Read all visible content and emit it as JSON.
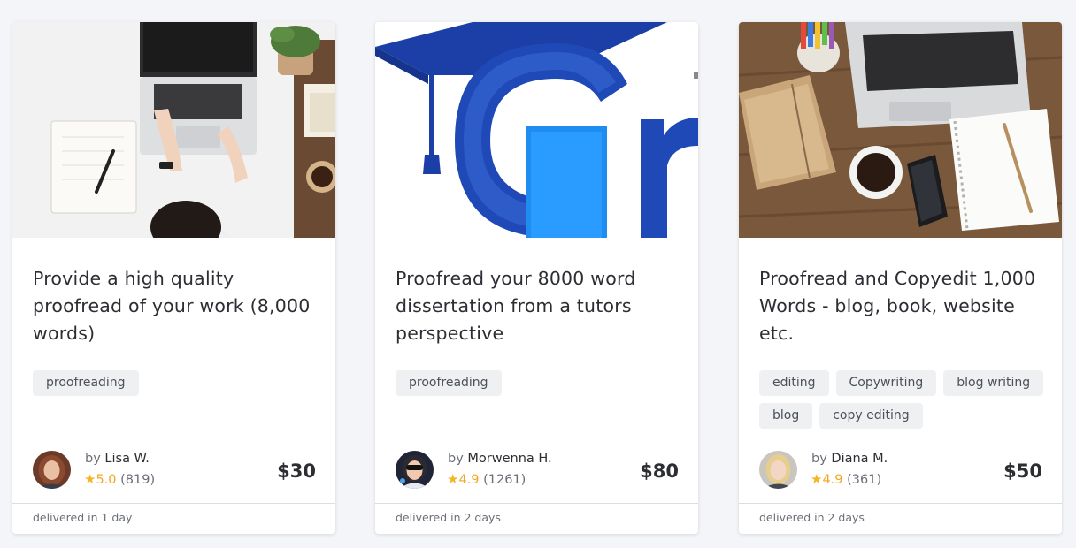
{
  "cards": [
    {
      "image_alt": "laptop-desk-photo",
      "title": "Provide a high quality proofread of your work (8,000 words)",
      "tags": [
        "proofreading"
      ],
      "seller": {
        "by": "by",
        "name": "Lisa W.",
        "rating": "5.0",
        "reviews": "(819)"
      },
      "price": "$30",
      "delivery": "delivered in 1 day"
    },
    {
      "image_alt": "graduation-logo-image",
      "title": "Proofread your 8000 word dissertation from a tutors perspective",
      "tags": [
        "proofreading"
      ],
      "seller": {
        "by": "by",
        "name": "Morwenna H.",
        "rating": "4.9",
        "reviews": "(1261)"
      },
      "price": "$80",
      "delivery": "delivered in 2 days"
    },
    {
      "image_alt": "desk-flatlay-photo",
      "title": "Proofread and Copyedit 1,000 Words - blog, book, website etc.",
      "tags": [
        "editing",
        "Copywriting",
        "blog writing",
        "blog",
        "copy editing"
      ],
      "seller": {
        "by": "by",
        "name": "Diana M.",
        "rating": "4.9",
        "reviews": "(361)"
      },
      "price": "$50",
      "delivery": "delivered in 2 days"
    }
  ],
  "colors": {
    "star": "#f5b623",
    "background": "#f4f5f8",
    "tag_bg": "#eff0f2"
  },
  "icons": {
    "rating": "star-icon"
  }
}
